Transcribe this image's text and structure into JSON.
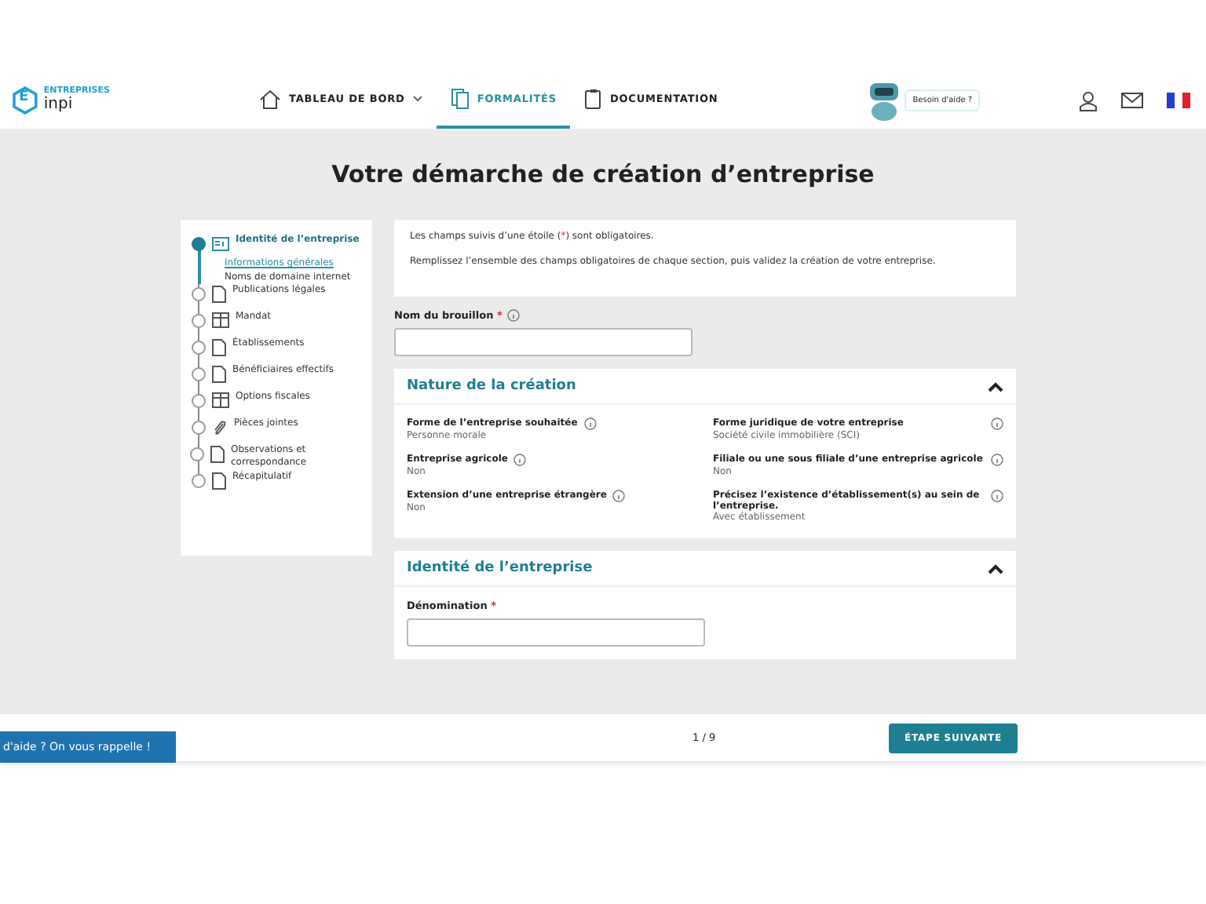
{
  "header": {
    "logo": {
      "letter": "E",
      "top": "ENTREPRISES",
      "bottom": "inpi"
    },
    "nav": [
      {
        "label": "TABLEAU DE BORD",
        "selected": false,
        "dropdown": true
      },
      {
        "label": "FORMALITÉS",
        "selected": true,
        "dropdown": false
      },
      {
        "label": "DOCUMENTATION",
        "selected": false,
        "dropdown": false
      }
    ],
    "help_bubble": "Besoin d'aide ?"
  },
  "title": "Votre démarche de création d’entreprise",
  "steps": [
    {
      "label": "Identité de l’entreprise",
      "selected": true,
      "children": [
        {
          "label": "Informations générales",
          "selected": true
        },
        {
          "label": "Noms de domaine internet",
          "selected": false
        }
      ]
    },
    {
      "label": "Publications légales",
      "selected": false
    },
    {
      "label": "Mandat",
      "selected": false
    },
    {
      "label": "Établissements",
      "selected": false
    },
    {
      "label": "Bénéficiaires effectifs",
      "selected": false
    },
    {
      "label": "Options fiscales",
      "selected": false
    },
    {
      "label": "Pièces jointes",
      "selected": false
    },
    {
      "label": "Observations et correspondance",
      "selected": false
    },
    {
      "label": "Récapitulatif",
      "selected": false
    }
  ],
  "notice": {
    "line1": {
      "before": "Les champs suivis d’une étoile (",
      "star": "*",
      "after": ") sont obligatoires."
    },
    "line2": "Remplissez l’ensemble des champs obligatoires de chaque section, puis validez la création de votre entreprise."
  },
  "draft_field": {
    "label": "Nom du brouillon",
    "mark": "*",
    "info": true
  },
  "sections": [
    {
      "title": "Nature de la création",
      "expanded": true,
      "kind": "summary",
      "fields": [
        {
          "label": "Forme de l’entreprise souhaitée",
          "value": "Personne morale"
        },
        {
          "label": "Forme juridique de votre entreprise",
          "value": "Société civile immobilière (SCI)"
        },
        {
          "label": "Entreprise agricole",
          "value": "Non"
        },
        {
          "label": "Filiale ou une sous filiale d’une entreprise agricole",
          "value": "Non"
        },
        {
          "label": "Extension d’une entreprise étrangère",
          "value": "Non"
        },
        {
          "label": "Précisez l’existence d’établissement(s) au sein de l’entreprise.",
          "value": "Avec établissement"
        }
      ]
    },
    {
      "title": "Identité de l’entreprise",
      "expanded": true,
      "kind": "form",
      "fields": [
        {
          "label": "Dénomination",
          "mark": "*"
        }
      ]
    }
  ],
  "footer": {
    "callback": "d'aide ? On vous rappelle !",
    "page": "1 / 9",
    "next": "ÉTAPE SUIVANTE"
  }
}
